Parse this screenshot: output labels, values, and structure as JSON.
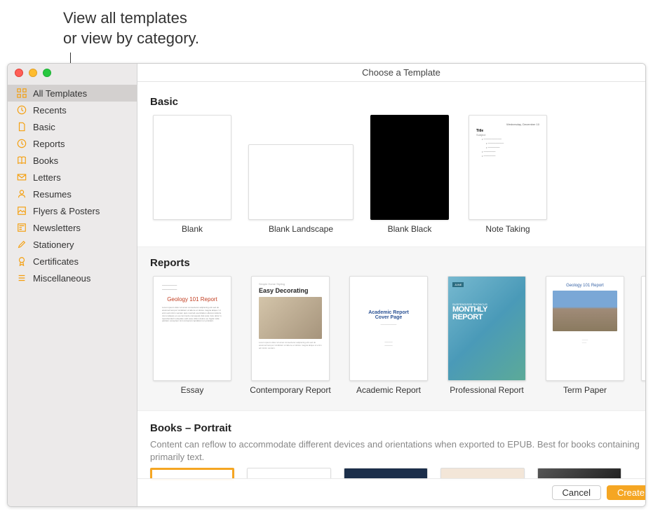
{
  "annotation": "View all templates\nor view by category.",
  "window": {
    "title": "Choose a Template"
  },
  "sidebar": {
    "items": [
      {
        "label": "All Templates",
        "selected": true
      },
      {
        "label": "Recents"
      },
      {
        "label": "Basic"
      },
      {
        "label": "Reports"
      },
      {
        "label": "Books"
      },
      {
        "label": "Letters"
      },
      {
        "label": "Resumes"
      },
      {
        "label": "Flyers & Posters"
      },
      {
        "label": "Newsletters"
      },
      {
        "label": "Stationery"
      },
      {
        "label": "Certificates"
      },
      {
        "label": "Miscellaneous"
      }
    ]
  },
  "sections": {
    "basic": {
      "header": "Basic",
      "templates": [
        {
          "label": "Blank"
        },
        {
          "label": "Blank Landscape"
        },
        {
          "label": "Blank Black"
        },
        {
          "label": "Note Taking"
        }
      ]
    },
    "reports": {
      "header": "Reports",
      "templates": [
        {
          "label": "Essay",
          "preview_title": "Geology 101 Report"
        },
        {
          "label": "Contemporary Report",
          "preview_subhead": "Simple Home Styling",
          "preview_title": "Easy Decorating"
        },
        {
          "label": "Academic Report",
          "preview_title": "Academic Report Cover Page"
        },
        {
          "label": "Professional Report",
          "preview_title": "MONTHLY REPORT"
        },
        {
          "label": "Term Paper",
          "preview_title": "Geology 101 Report"
        }
      ]
    },
    "books": {
      "header": "Books – Portrait",
      "description": "Content can reflow to accommodate different devices and orientations when exported to EPUB. Best for books containing primarily text."
    }
  },
  "footer": {
    "cancel": "Cancel",
    "create": "Create"
  }
}
